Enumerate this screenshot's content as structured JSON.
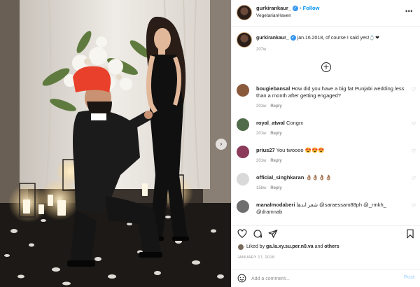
{
  "post": {
    "username": "gurkirankaur_",
    "follow_label": "Follow",
    "location": "VegetarianHaven",
    "verified_glyph": "✓",
    "more_glyph": "•••",
    "caption": {
      "username": "gurkirankaur_",
      "text": "jan.16.2018, of course I said yes!",
      "emoji": "💍❤",
      "age": "207w"
    },
    "load_more_glyph": "+",
    "comments": [
      {
        "username": "bougiebansal",
        "text": "How did you have a big fat Punjabi wedding less than a month after getting engaged?",
        "age": "201w",
        "reply": "Reply",
        "avatar_color": "#8a5a3c"
      },
      {
        "username": "royal_atwal",
        "text": "Congrx",
        "age": "201w",
        "reply": "Reply",
        "avatar_color": "#4f6b4a"
      },
      {
        "username": "prius27",
        "text": "You twoooo",
        "emoji": "😍😍😍",
        "age": "201w",
        "reply": "Reply",
        "avatar_color": "#8c3b5a"
      },
      {
        "username": "official_singhkaran",
        "text": "",
        "emoji": "👌🏽👌🏽👌🏽👌🏽",
        "age": "158w",
        "reply": "Reply",
        "avatar_color": "#d9d9d9"
      },
      {
        "username": "manalmodaberi",
        "text": "شعر ابدها @saraessam88ph @_rmkh_ @dramnab",
        "age": "",
        "reply": "",
        "avatar_color": "#6e6e6e"
      }
    ],
    "likes": {
      "prefix": "Liked by",
      "user": "ga.la.xy.su.per.n0.va",
      "connector": "and",
      "others": "others"
    },
    "date": "JANUARY 17, 2018",
    "add_comment": {
      "placeholder": "Add a comment...",
      "post_label": "Post"
    }
  },
  "icons": {
    "heart": "heart-icon",
    "comment": "comment-icon",
    "share": "share-icon",
    "bookmark": "bookmark-icon",
    "emoji": "emoji-icon",
    "more": "more-options-icon",
    "next": "chevron-right-icon"
  },
  "colors": {
    "link_blue": "#0095f6",
    "verified_blue": "#3897f0",
    "muted": "#8e8e8e",
    "post_disabled": "#b3dbff",
    "turban_red": "#e8402a"
  }
}
